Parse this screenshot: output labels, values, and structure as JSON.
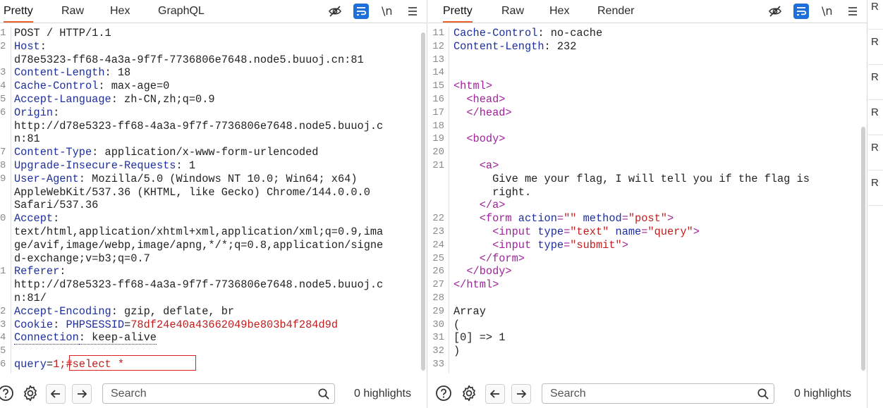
{
  "request": {
    "tabs": [
      "Pretty",
      "Raw",
      "Hex",
      "GraphQL"
    ],
    "active_tab": "Pretty",
    "toolbar": {
      "newline_label": "\\n"
    },
    "lines": [
      {
        "n": "1",
        "parts": [
          [
            "hv",
            "POST / HTTP/1.1"
          ]
        ]
      },
      {
        "n": "2",
        "parts": [
          [
            "hn",
            "Host"
          ],
          [
            "hv",
            ":"
          ]
        ]
      },
      {
        "n": "",
        "parts": [
          [
            "hv",
            "d78e5323-ff68-4a3a-9f7f-7736806e7648.node5.buuoj.cn:81"
          ]
        ]
      },
      {
        "n": "3",
        "parts": [
          [
            "hn",
            "Content-Length"
          ],
          [
            "hv",
            ": 18"
          ]
        ]
      },
      {
        "n": "4",
        "parts": [
          [
            "hn",
            "Cache-Control"
          ],
          [
            "hv",
            ": max-age=0"
          ]
        ]
      },
      {
        "n": "5",
        "parts": [
          [
            "hn",
            "Accept-Language"
          ],
          [
            "hv",
            ": zh-CN,zh;q=0.9"
          ]
        ]
      },
      {
        "n": "6",
        "parts": [
          [
            "hn",
            "Origin"
          ],
          [
            "hv",
            ":"
          ]
        ]
      },
      {
        "n": "",
        "parts": [
          [
            "hv",
            "http://d78e5323-ff68-4a3a-9f7f-7736806e7648.node5.buuoj.c"
          ]
        ]
      },
      {
        "n": "",
        "parts": [
          [
            "hv",
            "n:81"
          ]
        ]
      },
      {
        "n": "7",
        "parts": [
          [
            "hn",
            "Content-Type"
          ],
          [
            "hv",
            ": application/x-www-form-urlencoded"
          ]
        ]
      },
      {
        "n": "8",
        "parts": [
          [
            "hn",
            "Upgrade-Insecure-Requests"
          ],
          [
            "hv",
            ": 1"
          ]
        ]
      },
      {
        "n": "9",
        "parts": [
          [
            "hn",
            "User-Agent"
          ],
          [
            "hv",
            ": Mozilla/5.0 (Windows NT 10.0; Win64; x64)"
          ]
        ]
      },
      {
        "n": "",
        "parts": [
          [
            "hv",
            "AppleWebKit/537.36 (KHTML, like Gecko) Chrome/144.0.0.0"
          ]
        ]
      },
      {
        "n": "",
        "parts": [
          [
            "hv",
            "Safari/537.36"
          ]
        ]
      },
      {
        "n": "0",
        "parts": [
          [
            "hn",
            "Accept"
          ],
          [
            "hv",
            ":"
          ]
        ]
      },
      {
        "n": "",
        "parts": [
          [
            "hv",
            "text/html,application/xhtml+xml,application/xml;q=0.9,ima"
          ]
        ]
      },
      {
        "n": "",
        "parts": [
          [
            "hv",
            "ge/avif,image/webp,image/apng,*/*;q=0.8,application/signe"
          ]
        ]
      },
      {
        "n": "",
        "parts": [
          [
            "hv",
            "d-exchange;v=b3;q=0.7"
          ]
        ]
      },
      {
        "n": "1",
        "parts": [
          [
            "hn",
            "Referer"
          ],
          [
            "hv",
            ":"
          ]
        ]
      },
      {
        "n": "",
        "parts": [
          [
            "hv",
            "http://d78e5323-ff68-4a3a-9f7f-7736806e7648.node5.buuoj.c"
          ]
        ]
      },
      {
        "n": "",
        "parts": [
          [
            "hv",
            "n:81/"
          ]
        ]
      },
      {
        "n": "2",
        "parts": [
          [
            "hn",
            "Accept-Encoding"
          ],
          [
            "hv",
            ": gzip, deflate, br"
          ]
        ]
      },
      {
        "n": "3",
        "parts": [
          [
            "hn",
            "Cookie"
          ],
          [
            "hv",
            ": "
          ],
          [
            "ck",
            "PHPSESSID"
          ],
          [
            "hv",
            "="
          ],
          [
            "cv",
            "78df24e40a43662049be803b4f284d9d"
          ]
        ]
      },
      {
        "n": "4",
        "parts": [
          [
            "hn dotted",
            "Connection"
          ],
          [
            "hv dotted",
            ": keep-alive"
          ]
        ]
      },
      {
        "n": "5",
        "parts": []
      },
      {
        "n": "6",
        "parts": [
          [
            "pk",
            "query"
          ],
          [
            "hv",
            "="
          ],
          [
            "pv",
            "1;#select *"
          ]
        ]
      }
    ],
    "search": {
      "placeholder": "Search"
    },
    "highlights": "0 highlights"
  },
  "response": {
    "tabs": [
      "Pretty",
      "Raw",
      "Hex",
      "Render"
    ],
    "active_tab": "Pretty",
    "toolbar": {
      "newline_label": "\\n"
    },
    "lines": [
      {
        "n": "11",
        "parts": [
          [
            "hn",
            "Cache-Control"
          ],
          [
            "hv",
            ": no-cache"
          ]
        ]
      },
      {
        "n": "12",
        "parts": [
          [
            "hn",
            "Content-Length"
          ],
          [
            "hv",
            ": 232"
          ]
        ]
      },
      {
        "n": "13",
        "parts": []
      },
      {
        "n": "14",
        "parts": []
      },
      {
        "n": "15",
        "parts": [
          [
            "tag",
            "<html>"
          ]
        ]
      },
      {
        "n": "16",
        "parts": [
          [
            "txt",
            "  "
          ],
          [
            "tag",
            "<head>"
          ]
        ]
      },
      {
        "n": "17",
        "parts": [
          [
            "txt",
            "  "
          ],
          [
            "tag",
            "</head>"
          ]
        ]
      },
      {
        "n": "18",
        "parts": []
      },
      {
        "n": "19",
        "parts": [
          [
            "txt",
            "  "
          ],
          [
            "tag",
            "<body>"
          ]
        ]
      },
      {
        "n": "20",
        "parts": []
      },
      {
        "n": "21",
        "parts": [
          [
            "txt",
            "    "
          ],
          [
            "tag",
            "<a>"
          ]
        ]
      },
      {
        "n": "",
        "parts": [
          [
            "txt",
            "      Give me your flag, I will tell you if the flag is"
          ]
        ]
      },
      {
        "n": "",
        "parts": [
          [
            "txt",
            "      right."
          ]
        ]
      },
      {
        "n": "",
        "parts": [
          [
            "txt",
            "    "
          ],
          [
            "tag",
            "</a>"
          ]
        ]
      },
      {
        "n": "22",
        "parts": [
          [
            "txt",
            "    "
          ],
          [
            "tag",
            "<form "
          ],
          [
            "attr",
            "action"
          ],
          [
            "tag",
            "="
          ],
          [
            "aval",
            "\"\""
          ],
          [
            "txt",
            " "
          ],
          [
            "attr",
            "method"
          ],
          [
            "tag",
            "="
          ],
          [
            "aval",
            "\"post\""
          ],
          [
            "tag",
            ">"
          ]
        ]
      },
      {
        "n": "23",
        "parts": [
          [
            "txt",
            "      "
          ],
          [
            "tag",
            "<input "
          ],
          [
            "attr",
            "type"
          ],
          [
            "tag",
            "="
          ],
          [
            "aval",
            "\"text\""
          ],
          [
            "txt",
            " "
          ],
          [
            "attr",
            "name"
          ],
          [
            "tag",
            "="
          ],
          [
            "aval",
            "\"query\""
          ],
          [
            "tag",
            ">"
          ]
        ]
      },
      {
        "n": "24",
        "parts": [
          [
            "txt",
            "      "
          ],
          [
            "tag",
            "<input "
          ],
          [
            "attr",
            "type"
          ],
          [
            "tag",
            "="
          ],
          [
            "aval",
            "\"submit\""
          ],
          [
            "tag",
            ">"
          ]
        ]
      },
      {
        "n": "25",
        "parts": [
          [
            "txt",
            "    "
          ],
          [
            "tag",
            "</form>"
          ]
        ]
      },
      {
        "n": "26",
        "parts": [
          [
            "txt",
            "  "
          ],
          [
            "tag",
            "</body>"
          ]
        ]
      },
      {
        "n": "27",
        "parts": [
          [
            "tag",
            "</html>"
          ]
        ]
      },
      {
        "n": "28",
        "parts": []
      },
      {
        "n": "29",
        "parts": [
          [
            "txt",
            "Array"
          ]
        ]
      },
      {
        "n": "30",
        "parts": [
          [
            "txt",
            "("
          ]
        ]
      },
      {
        "n": "31",
        "parts": [
          [
            "txt",
            "[0] => 1"
          ]
        ]
      },
      {
        "n": "32",
        "parts": [
          [
            "txt",
            ")"
          ]
        ]
      },
      {
        "n": "33",
        "parts": []
      }
    ],
    "search": {
      "placeholder": "Search"
    },
    "highlights": "0 highlights"
  },
  "sidebar": {
    "items": [
      "R",
      "R",
      "R",
      "R",
      "R",
      "R"
    ]
  },
  "colors": {
    "accent": "#e8632a",
    "toolbar_blue": "#1e6fd9"
  }
}
